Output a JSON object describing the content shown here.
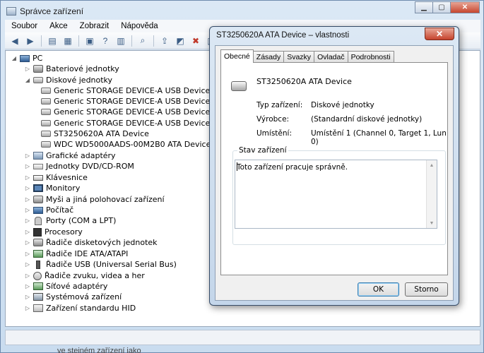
{
  "main_window": {
    "title": "Správce zařízení",
    "menu": [
      "Soubor",
      "Akce",
      "Zobrazit",
      "Nápověda"
    ],
    "bottom_text": "ve stejném zařízení jako"
  },
  "tree": {
    "root": "PC",
    "nodes": [
      {
        "label": "Bateriové jednotky",
        "icon": "battery-icon",
        "expander": "▷"
      },
      {
        "label": "Diskové jednotky",
        "icon": "disk-drive-icon",
        "expander": "◢"
      },
      {
        "label": "Generic STORAGE DEVICE-A USB Device",
        "icon": "disk-icon",
        "child": true
      },
      {
        "label": "Generic STORAGE DEVICE-A USB Device",
        "icon": "disk-icon",
        "child": true
      },
      {
        "label": "Generic STORAGE DEVICE-A USB Device",
        "icon": "disk-icon",
        "child": true
      },
      {
        "label": "Generic STORAGE DEVICE-A USB Device",
        "icon": "disk-icon",
        "child": true
      },
      {
        "label": "ST3250620A ATA Device",
        "icon": "disk-icon",
        "child": true
      },
      {
        "label": "WDC WD5000AADS-00M2B0 ATA Device",
        "icon": "disk-icon",
        "child": true
      },
      {
        "label": "Grafické adaptéry",
        "icon": "display-adapter-icon",
        "expander": "▷"
      },
      {
        "label": "Jednotky DVD/CD-ROM",
        "icon": "dvd-drive-icon",
        "expander": "▷"
      },
      {
        "label": "Klávesnice",
        "icon": "keyboard-icon",
        "expander": "▷"
      },
      {
        "label": "Monitory",
        "icon": "monitor-icon",
        "expander": "▷"
      },
      {
        "label": "Myši a jiná polohovací zařízení",
        "icon": "mouse-icon",
        "expander": "▷"
      },
      {
        "label": "Počítač",
        "icon": "computer-icon",
        "expander": "▷"
      },
      {
        "label": "Porty (COM a LPT)",
        "icon": "port-icon",
        "expander": "▷"
      },
      {
        "label": "Procesory",
        "icon": "processor-icon",
        "expander": "▷"
      },
      {
        "label": "Řadiče disketových jednotek",
        "icon": "floppy-controller-icon",
        "expander": "▷"
      },
      {
        "label": "Řadiče IDE ATA/ATAPI",
        "icon": "ide-controller-icon",
        "expander": "▷"
      },
      {
        "label": "Řadiče USB (Universal Serial Bus)",
        "icon": "usb-icon",
        "expander": "▷"
      },
      {
        "label": "Řadiče zvuku, videa a her",
        "icon": "sound-icon",
        "expander": "▷"
      },
      {
        "label": "Síťové adaptéry",
        "icon": "network-adapter-icon",
        "expander": "▷"
      },
      {
        "label": "Systémová zařízení",
        "icon": "system-device-icon",
        "expander": "▷"
      },
      {
        "label": "Zařízení standardu HID",
        "icon": "hid-icon",
        "expander": "▷"
      }
    ]
  },
  "dialog": {
    "title": "ST3250620A ATA Device – vlastnosti",
    "close_label": "✕",
    "tabs": [
      "Obecné",
      "Zásady",
      "Svazky",
      "Ovladač",
      "Podrobnosti"
    ],
    "active_tab": "Obecné",
    "device_name": "ST3250620A ATA Device",
    "properties": [
      {
        "label": "Typ zařízení:",
        "value": "Diskové jednotky"
      },
      {
        "label": "Výrobce:",
        "value": "(Standardní diskové jednotky)"
      },
      {
        "label": "Umístění:",
        "value": "Umístění 1 (Channel 0, Target 1, Lun 0)"
      }
    ],
    "status_group_label": "Stav zařízení",
    "status_text": "Toto zařízení pracuje správně.",
    "ok_label": "OK",
    "cancel_label": "Storno"
  }
}
